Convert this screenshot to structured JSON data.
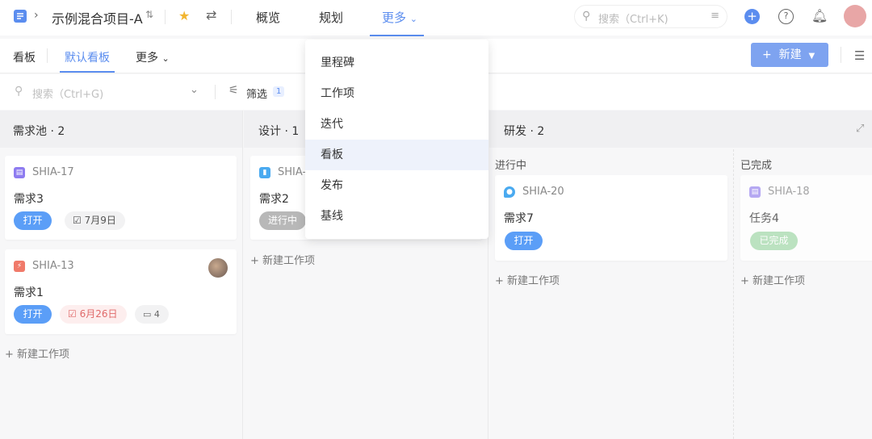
{
  "header": {
    "project_name": "示例混合项目-A",
    "nav": [
      "概览",
      "规划",
      "更多"
    ],
    "search_placeholder": "搜索（Ctrl+K)"
  },
  "subbar": {
    "title": "看板",
    "active_tab": "默认看板",
    "more": "更多",
    "new_button": "新建"
  },
  "filterbar": {
    "search_placeholder": "搜索（Ctrl+G)",
    "filter_label": "筛选",
    "filter_count": "1"
  },
  "columns": [
    {
      "title": "需求池 · 2"
    },
    {
      "title": "设计 · 1"
    },
    {
      "title": "研发 · 2",
      "sub_columns": [
        "进行中",
        "已完成"
      ]
    }
  ],
  "cards": [
    {
      "key": "SHIA-17",
      "title": "需求3",
      "status": "打开",
      "date": "7月9日"
    },
    {
      "key": "SHIA-13",
      "title": "需求1",
      "status": "打开",
      "date": "6月26日",
      "comments": "4"
    },
    {
      "key": "SHIA-",
      "title": "需求2",
      "status": "进行中"
    },
    {
      "key": "SHIA-20",
      "title": "需求7",
      "status": "打开"
    },
    {
      "key": "SHIA-18",
      "title": "任务4",
      "status": "已完成"
    }
  ],
  "add_item_label": "新建工作项",
  "dropdown": {
    "items": [
      "里程碑",
      "工作项",
      "迭代",
      "看板",
      "发布",
      "基线"
    ],
    "active_index": 3
  },
  "colors": {
    "accent": "#5b8def",
    "open": "#5b9ef7",
    "in_progress": "#b8b8b8",
    "done": "#a8dcae",
    "due_overdue": "#e06a6a"
  }
}
